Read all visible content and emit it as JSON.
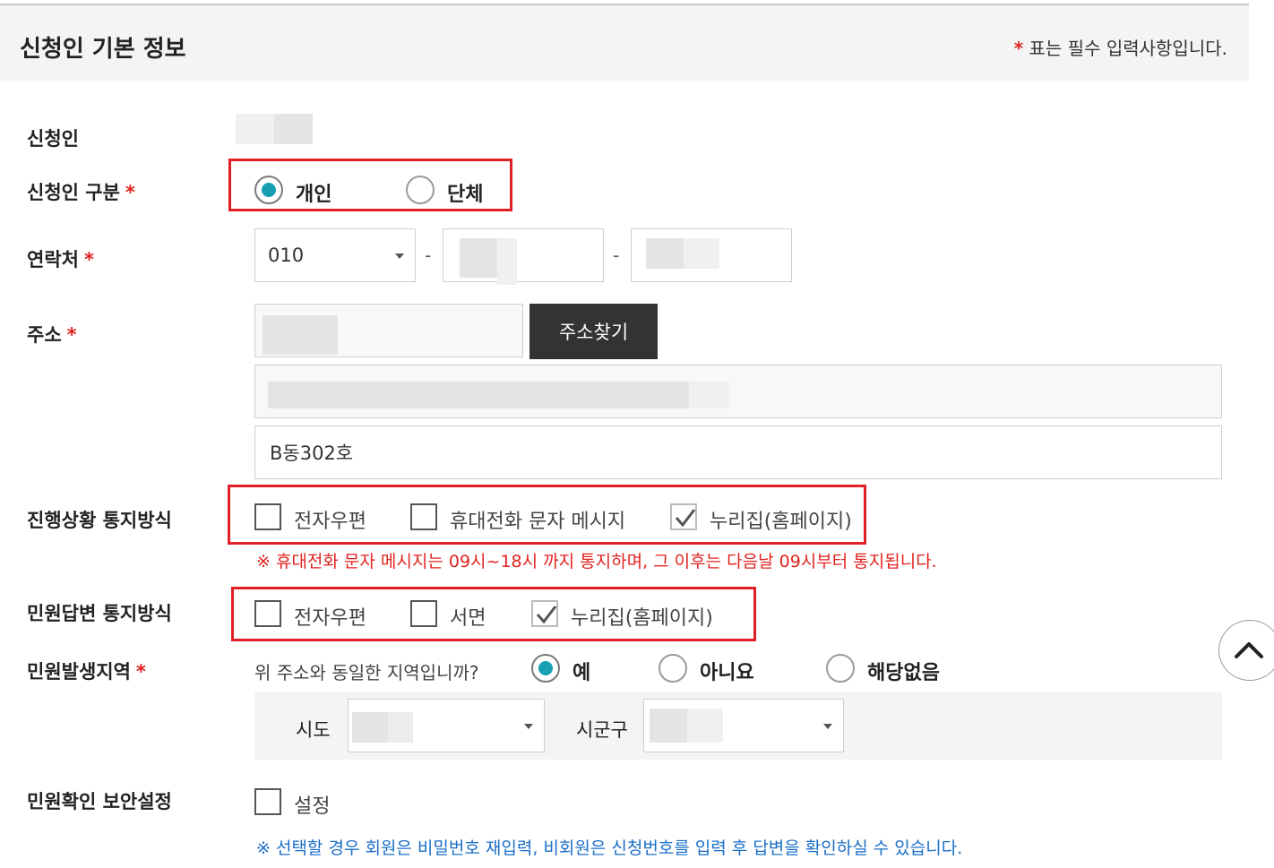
{
  "header": {
    "title": "신청인 기본 정보",
    "required_mark": "*",
    "required_note": "표는 필수 입력사항입니다."
  },
  "labels": {
    "applicant": "신청인",
    "applicant_type": "신청인 구분",
    "contact": "연락처",
    "address": "주소",
    "progress_notify": "진행상황 통지방식",
    "answer_notify": "민원답변 통지방식",
    "region": "민원발생지역",
    "security": "민원확인 보안설정",
    "required_mark": "*"
  },
  "applicant_type": {
    "options": [
      {
        "label": "개인",
        "selected": true
      },
      {
        "label": "단체",
        "selected": false
      }
    ]
  },
  "contact": {
    "prefix_value": "010",
    "separator": "-"
  },
  "address": {
    "search_button": "주소찾기",
    "detail_value": "B동302호"
  },
  "progress_notify": {
    "options": [
      {
        "label": "전자우편",
        "checked": false
      },
      {
        "label": "휴대전화 문자 메시지",
        "checked": false
      },
      {
        "label": "누리집(홈페이지)",
        "checked": true
      }
    ],
    "notice": "※ 휴대전화 문자 메시지는 09시~18시 까지 통지하며, 그 이후는 다음날 09시부터 통지됩니다."
  },
  "answer_notify": {
    "options": [
      {
        "label": "전자우편",
        "checked": false
      },
      {
        "label": "서면",
        "checked": false
      },
      {
        "label": "누리집(홈페이지)",
        "checked": true
      }
    ]
  },
  "region": {
    "question": "위 주소와 동일한 지역입니까?",
    "options": [
      {
        "label": "예",
        "selected": true
      },
      {
        "label": "아니요",
        "selected": false
      },
      {
        "label": "해당없음",
        "selected": false
      }
    ],
    "sido_label": "시도",
    "sigungu_label": "시군구"
  },
  "security": {
    "option_label": "설정",
    "checked": false,
    "notice": "※ 선택할 경우 회원은 비밀번호 재입력, 비회원은 신청번호를 입력 후 답변을 확인하실 수 있습니다."
  },
  "colors": {
    "accent_radio": "#17a0b4",
    "required": "#e0231f",
    "highlight_box": "#e01f26",
    "notice_blue": "#1a6ec7",
    "button_dark": "#333333"
  },
  "icons": {
    "dropdown": "caret-down-icon",
    "check": "checkmark-icon",
    "scroll_top": "chevron-up-icon"
  }
}
